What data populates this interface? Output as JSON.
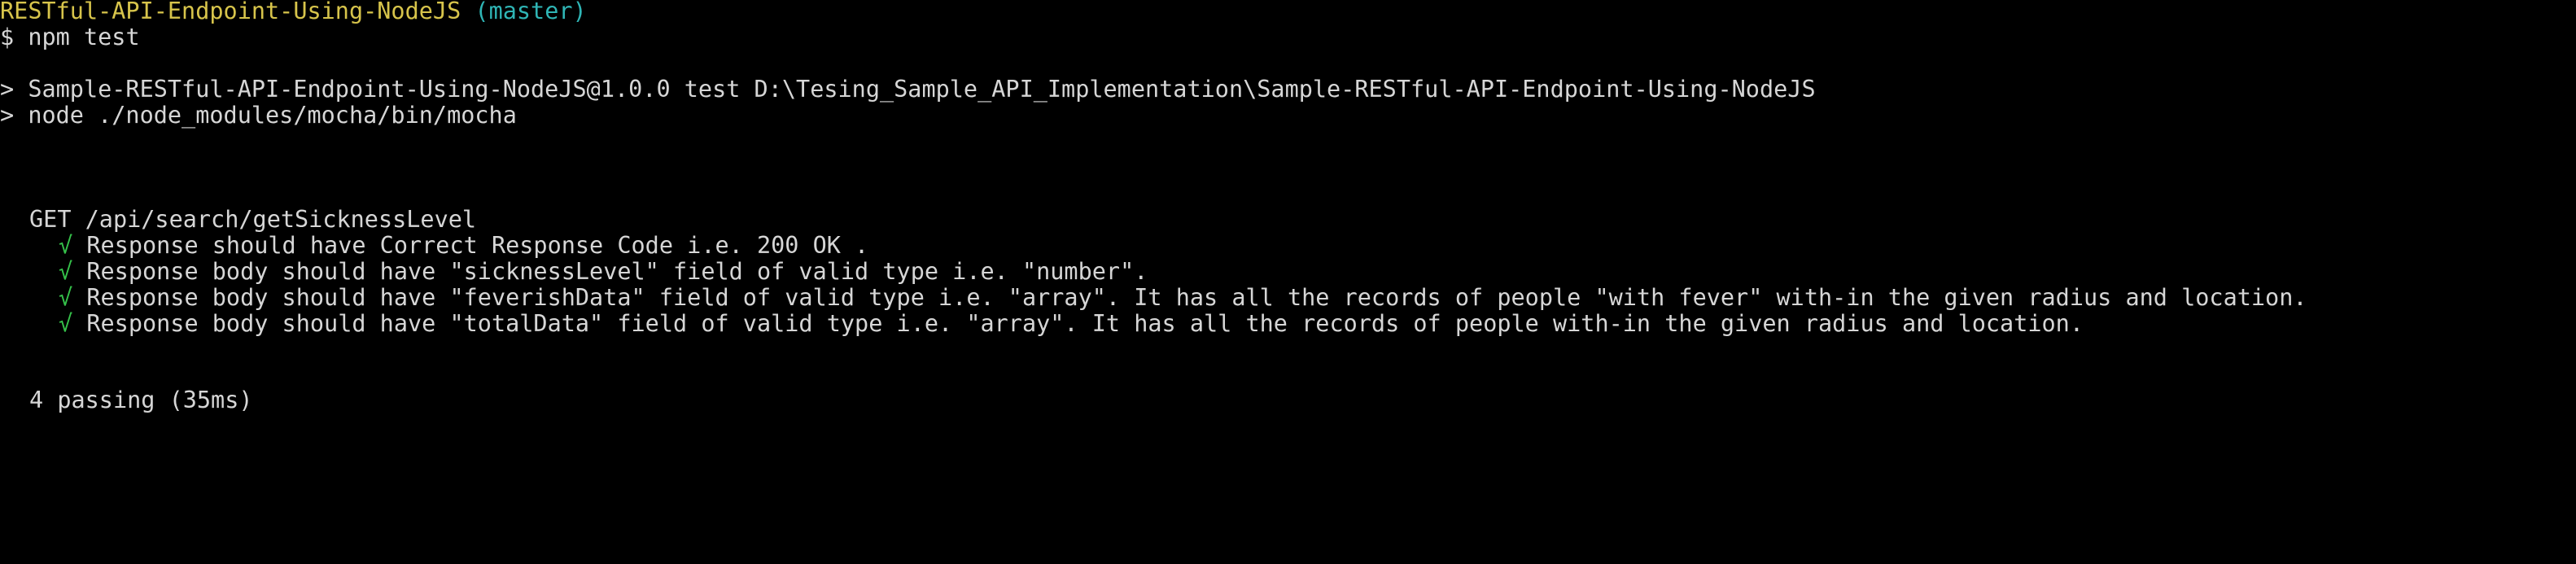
{
  "prompt": {
    "directory": "RESTful-API-Endpoint-Using-NodeJS",
    "branch": "(master)",
    "symbol": "$",
    "command": "npm test"
  },
  "npm_output": [
    "> Sample-RESTful-API-Endpoint-Using-NodeJS@1.0.0 test D:\\Tesing_Sample_API_Implementation\\Sample-RESTful-API-Endpoint-Using-NodeJS",
    "> node ./node_modules/mocha/bin/mocha"
  ],
  "suite": {
    "title": "GET /api/search/getSicknessLevel",
    "check_mark": "√",
    "tests": [
      "Response should have Correct Response Code i.e. 200 OK .",
      "Response body should have \"sicknessLevel\" field of valid type i.e. \"number\".",
      "Response body should have \"feverishData\" field of valid type i.e. \"array\". It has all the records of people \"with fever\" with-in the given radius and location.",
      "Response body should have \"totalData\" field of valid type i.e. \"array\". It has all the records of people with-in the given radius and location."
    ]
  },
  "summary": "4 passing (35ms)",
  "colors": {
    "background": "#000000",
    "text": "#d6d6d6",
    "prompt_directory": "#d7c44b",
    "prompt_branch": "#2fb5b5",
    "pass_check": "#35c24a"
  }
}
